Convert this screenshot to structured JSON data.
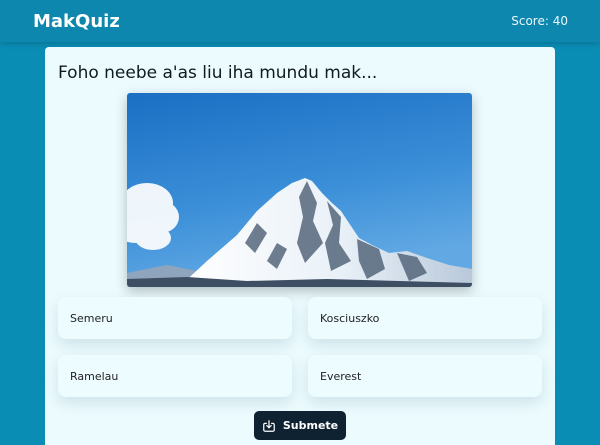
{
  "header": {
    "brand": "MakQuiz",
    "score": "Score: 40"
  },
  "quiz": {
    "question": "Foho neebe a'as liu iha mundu mak...",
    "image": "snow-capped-mountain-photo",
    "options": [
      {
        "label": "Semeru"
      },
      {
        "label": "Kosciuszko"
      },
      {
        "label": "Ramelau"
      },
      {
        "label": "Everest"
      }
    ],
    "submit_label": "Submete",
    "submit_icon": "download-tray-icon"
  },
  "colors": {
    "background": "#0a8db5",
    "topbar": "#0d87ae",
    "card": "#ebfbfe",
    "option": "#edfcff",
    "submit": "#0f2232"
  }
}
